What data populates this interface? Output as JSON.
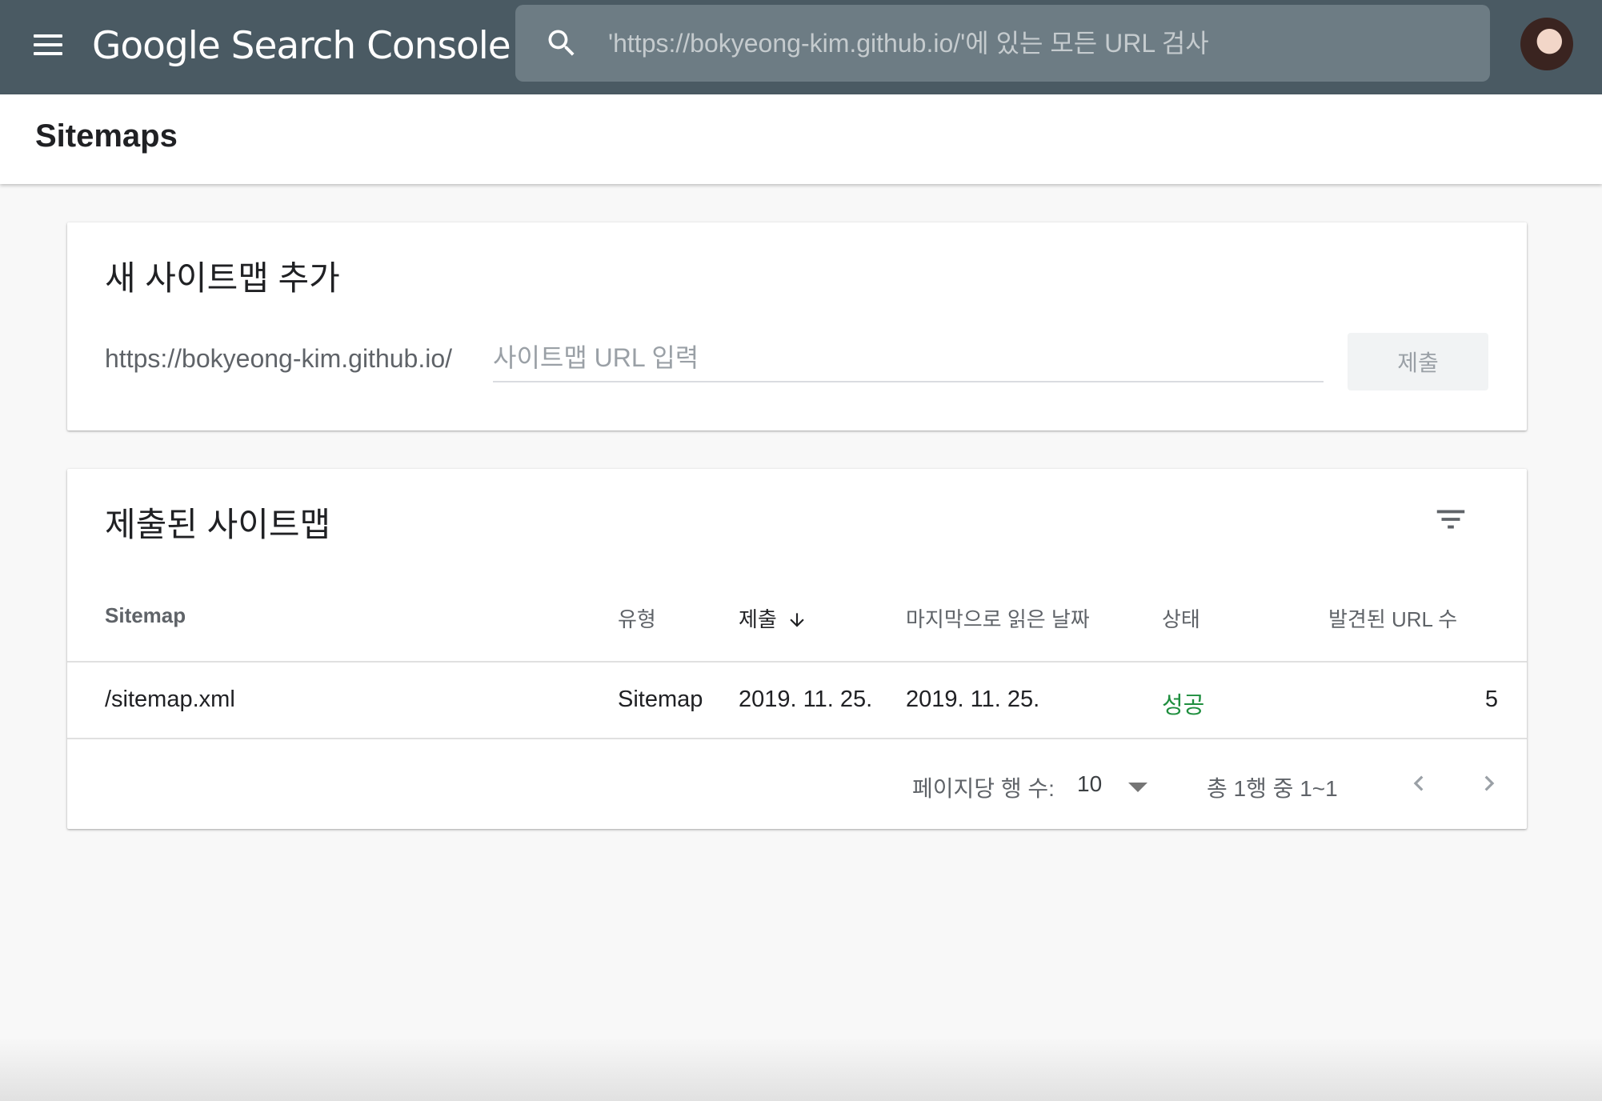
{
  "appbar": {
    "product_name": "Google Search Console",
    "search_placeholder": "'https://bokyeong-kim.github.io/'에 있는 모든 URL 검사",
    "bg_color": "#4a5a63"
  },
  "page": {
    "title": "Sitemaps"
  },
  "add_sitemap": {
    "title": "새 사이트맵 추가",
    "url_prefix": "https://bokyeong-kim.github.io/",
    "input_placeholder": "사이트맵 URL 입력",
    "submit_label": "제출"
  },
  "submitted_sitemaps": {
    "title": "제출된 사이트맵",
    "columns": {
      "sitemap": "Sitemap",
      "type": "유형",
      "submitted": "제출",
      "last_read": "마지막으로 읽은 날짜",
      "status": "상태",
      "discovered_urls": "발견된 URL 수"
    },
    "rows": [
      {
        "sitemap": "/sitemap.xml",
        "type": "Sitemap",
        "submitted": "2019. 11. 25.",
        "last_read": "2019. 11. 25.",
        "status": "성공",
        "discovered_urls": "5"
      }
    ],
    "pagination": {
      "rows_per_page_label": "페이지당 행 수:",
      "rows_per_page_value": "10",
      "range_label": "총 1행 중 1~1"
    },
    "status_color": "#1e8e3e"
  },
  "icons": {
    "menu": "menu-icon",
    "search": "search-icon",
    "filter": "filter-icon",
    "sort": "arrow-down-icon",
    "dropdown": "caret-down-icon",
    "prev": "chevron-left-icon",
    "next": "chevron-right-icon"
  }
}
